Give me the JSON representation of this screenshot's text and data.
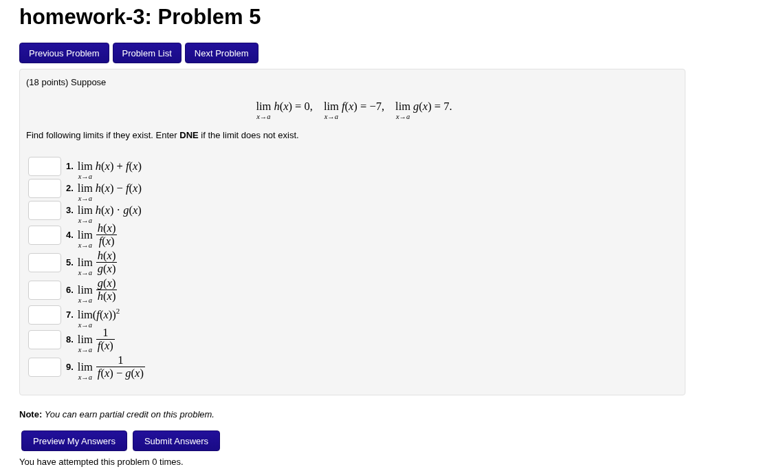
{
  "page_title": "homework-3: Problem 5",
  "nav_buttons": [
    "Previous Problem",
    "Problem List",
    "Next Problem"
  ],
  "problem": {
    "intro": "(18 points) Suppose",
    "given": [
      {
        "operator": "lim",
        "limit_under": "x→a",
        "expression": "*h*(*x*) = 0,"
      },
      {
        "operator": "lim",
        "limit_under": "x→a",
        "expression": "*f*(*x*) = −7,"
      },
      {
        "operator": "lim",
        "limit_under": "x→a",
        "expression": "*g*(*x*) = 7."
      }
    ],
    "instruction": "Find following limits if they exist. Enter **DNE** if the limit does not exist.",
    "parts": [
      {
        "number": "1.",
        "kind": "inline",
        "operator": "lim",
        "limit_under": "x→a",
        "expression": "*h*(*x*) + *f*(*x*)"
      },
      {
        "number": "2.",
        "kind": "inline",
        "operator": "lim",
        "limit_under": "x→a",
        "expression": "*h*(*x*) − *f*(*x*)"
      },
      {
        "number": "3.",
        "kind": "inline",
        "operator": "lim",
        "limit_under": "x→a",
        "expression": "*h*(*x*) · *g*(*x*)"
      },
      {
        "number": "4.",
        "kind": "fraction",
        "operator": "lim",
        "limit_under": "x→a",
        "numerator": "*h*(*x*)",
        "denominator": "*f*(*x*)"
      },
      {
        "number": "5.",
        "kind": "fraction",
        "operator": "lim",
        "limit_under": "x→a",
        "numerator": "*h*(*x*)",
        "denominator": "*g*(*x*)"
      },
      {
        "number": "6.",
        "kind": "fraction",
        "operator": "lim",
        "limit_under": "x→a",
        "numerator": "*g*(*x*)",
        "denominator": "*h*(*x*)"
      },
      {
        "number": "7.",
        "kind": "attached",
        "operator": "lim",
        "limit_under": "x→a",
        "expression": "(*f*(*x*))$^{2}$"
      },
      {
        "number": "8.",
        "kind": "fraction",
        "operator": "lim",
        "limit_under": "x→a",
        "numerator": "1",
        "denominator": "*f*(*x*)"
      },
      {
        "number": "9.",
        "kind": "fraction",
        "operator": "lim",
        "limit_under": "x→a",
        "numerator": "1",
        "denominator": "*f*(*x*) − *g*(*x*)"
      }
    ]
  },
  "note": "**Note:** *You can earn partial credit on this problem.*",
  "action_buttons": [
    "Preview My Answers",
    "Submit Answers"
  ],
  "attempts_text": "You have attempted this problem 0 times."
}
